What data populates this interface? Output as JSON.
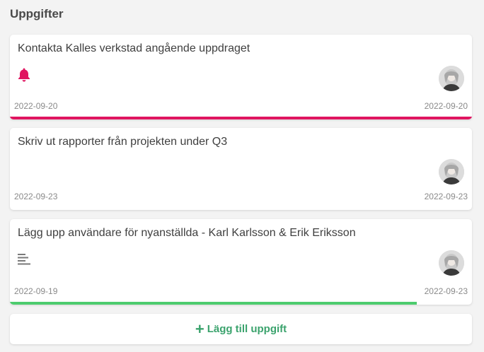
{
  "header": {
    "title": "Uppgifter"
  },
  "colors": {
    "alert_pink": "#e01560",
    "success_green": "#4dcc6e",
    "add_green": "#3ba36d",
    "icon_gray": "#7a7a7a"
  },
  "tasks": [
    {
      "title": "Kontakta Kalles verkstad angående uppdraget",
      "start_date": "2022-09-20",
      "due_date": "2022-09-20",
      "icon": "bell-icon",
      "progress": 1.0
    },
    {
      "title": "Skriv ut rapporter från projekten under Q3",
      "start_date": "2022-09-23",
      "due_date": "2022-09-23",
      "icon": null,
      "progress": 0
    },
    {
      "title": "Lägg upp användare för nyanställda - Karl Karlsson & Erik Eriksson",
      "start_date": "2022-09-19",
      "due_date": "2022-09-23",
      "icon": "description-lines-icon",
      "progress": 0.88
    }
  ],
  "add_task": {
    "plus": "+",
    "label": "Lägg till uppgift"
  }
}
